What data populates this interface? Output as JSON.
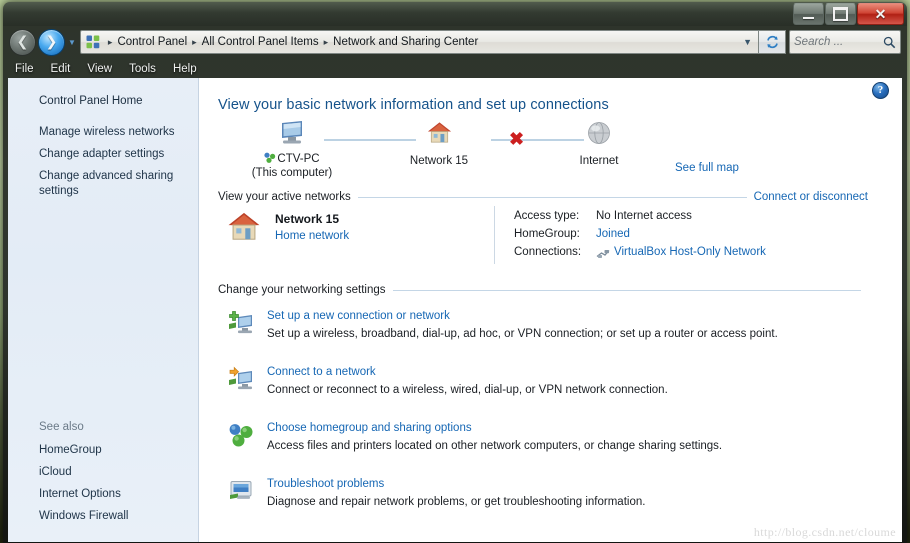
{
  "window": {
    "controls": {
      "minimize": "Minimize",
      "maximize": "Maximize",
      "close": "Close"
    }
  },
  "navbar": {
    "back_label": "Back",
    "forward_label": "Forward",
    "recent_pages_label": "Recent pages",
    "breadcrumbs": [
      "Control Panel",
      "All Control Panel Items",
      "Network and Sharing Center"
    ],
    "separator": "▸",
    "address_dropdown": "▼",
    "refresh_label": "Refresh",
    "search": {
      "placeholder": "Search ...",
      "value": "",
      "icon": "search-icon"
    }
  },
  "menubar": {
    "items": [
      "File",
      "Edit",
      "View",
      "Tools",
      "Help"
    ]
  },
  "sidebar": {
    "home_link": "Control Panel Home",
    "tasks": [
      "Manage wireless networks",
      "Change adapter settings",
      "Change advanced sharing settings"
    ],
    "see_also_heading": "See also",
    "see_also": [
      "HomeGroup",
      "iCloud",
      "Internet Options",
      "Windows Firewall"
    ]
  },
  "main": {
    "help_glyph": "?",
    "page_title": "View your basic network information and set up connections",
    "network_map": {
      "see_full_map": "See full map",
      "nodes": [
        {
          "icon": "computer-icon",
          "label": "CTV-PC",
          "sublabel": "(This computer)"
        },
        {
          "icon": "home-network-icon",
          "label": "Network  15",
          "sublabel": ""
        },
        {
          "icon": "internet-globe-icon",
          "label": "Internet",
          "sublabel": ""
        }
      ],
      "connection_broken_marker": "✖"
    },
    "active_networks": {
      "heading": "View your active networks",
      "action_link": "Connect or disconnect",
      "network": {
        "icon": "home-network-icon",
        "name": "Network  15",
        "type_link": "Home network"
      },
      "details": [
        {
          "label": "Access type:",
          "value": "No Internet access",
          "is_link": false,
          "icon": ""
        },
        {
          "label": "HomeGroup:",
          "value": "Joined",
          "is_link": true,
          "icon": ""
        },
        {
          "label": "Connections:",
          "value": "VirtualBox Host-Only Network",
          "is_link": true,
          "icon": "network-adapter-icon"
        }
      ]
    },
    "settings": {
      "heading": "Change your networking settings",
      "items": [
        {
          "icon": "new-connection-icon",
          "title": "Set up a new connection or network",
          "description": "Set up a wireless, broadband, dial-up, ad hoc, or VPN connection; or set up a router or access point."
        },
        {
          "icon": "connect-network-icon",
          "title": "Connect to a network",
          "description": "Connect or reconnect to a wireless, wired, dial-up, or VPN network connection."
        },
        {
          "icon": "homegroup-icon",
          "title": "Choose homegroup and sharing options",
          "description": "Access files and printers located on other network computers, or change sharing settings."
        },
        {
          "icon": "troubleshoot-icon",
          "title": "Troubleshoot problems",
          "description": "Diagnose and repair network problems, or get troubleshooting information."
        }
      ]
    }
  },
  "watermark": "http://blog.csdn.net/cloume",
  "colors": {
    "link": "#1667b4",
    "title": "#16538b",
    "sidebar_bg": "#e5edf7",
    "error_red": "#cc1f1f",
    "close_button": "#b02014"
  }
}
